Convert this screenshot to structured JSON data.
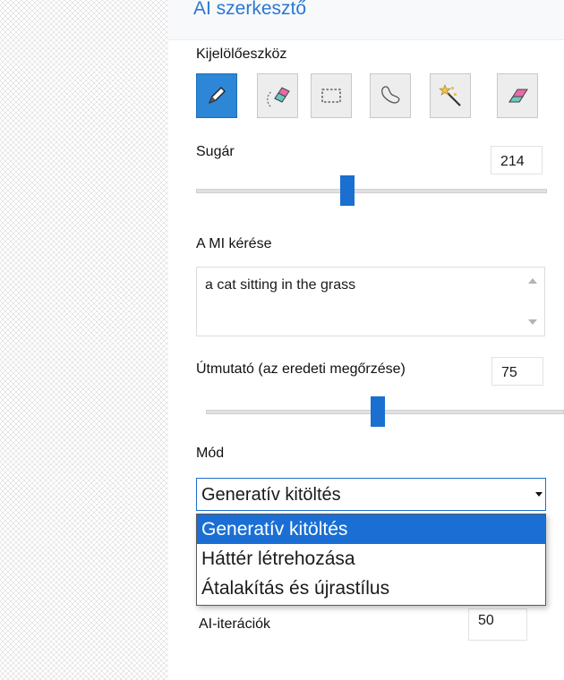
{
  "panel": {
    "title": "AI szerkesztő",
    "selection_tool_label": "Kijelölőeszköz",
    "tools": [
      {
        "name": "brush-tool",
        "icon": "pencil-icon",
        "active": true
      },
      {
        "name": "smart-eraser-tool",
        "icon": "lasso-eraser-icon",
        "active": false
      },
      {
        "name": "rectangle-select-tool",
        "icon": "dashed-rectangle-icon",
        "active": false
      },
      {
        "name": "lasso-tool",
        "icon": "lasso-icon",
        "active": false
      },
      {
        "name": "magic-wand-tool",
        "icon": "magic-wand-icon",
        "active": false
      },
      {
        "name": "eraser-tool",
        "icon": "eraser-icon",
        "active": false
      }
    ],
    "radius": {
      "label": "Sugár",
      "value": "214",
      "slider_fraction": 0.43
    },
    "prompt": {
      "label": "A MI kérése",
      "value": "a cat sitting in the grass"
    },
    "guidance": {
      "label": "Útmutató (az eredeti megőrzése)",
      "value": "75",
      "slider_fraction": 0.48
    },
    "mode": {
      "label": "Mód",
      "selected": "Generatív kitöltés",
      "options": [
        "Generatív kitöltés",
        "Háttér létrehozása",
        "Átalakítás és újrastílus"
      ]
    },
    "iterations": {
      "label": "AI-iterációk",
      "value": "50"
    }
  },
  "colors": {
    "accent": "#2a78d2",
    "active_tool": "#2d86d6",
    "slider_thumb": "#1a6fd1",
    "selection": "#1b6fd4"
  }
}
